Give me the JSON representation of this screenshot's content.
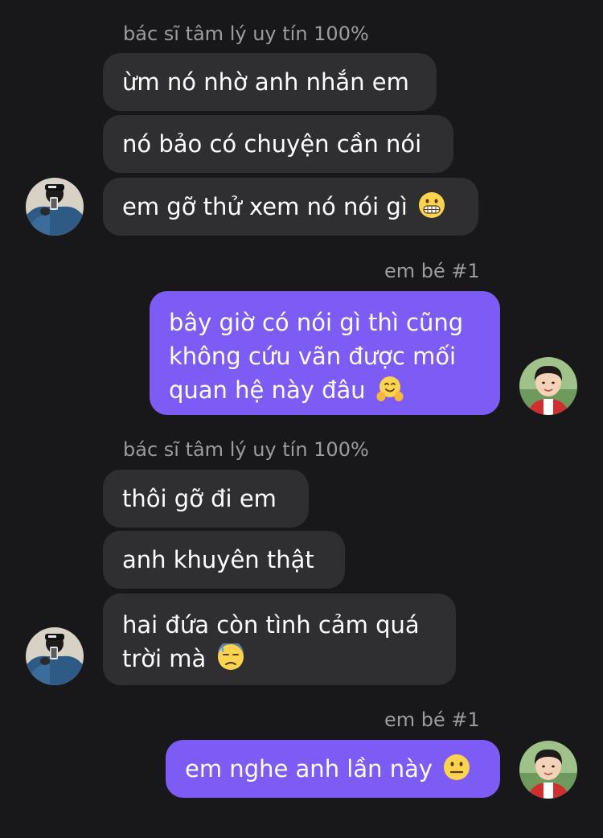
{
  "conversation": {
    "groups": [
      {
        "sender": "bác sĩ tâm lý uy tín 100%",
        "direction": "incoming",
        "avatar": "avatar-man-hoodie-icon",
        "messages": [
          {
            "text": "ừm nó nhờ anh nhắn em"
          },
          {
            "text": "nó bảo có chuyện cần nói"
          },
          {
            "text": "em gỡ thử xem nó nói gì",
            "emoji": "grimacing-face-icon"
          }
        ]
      },
      {
        "sender": "em bé #1",
        "direction": "outgoing",
        "avatar": "avatar-child-icon",
        "messages": [
          {
            "lines": [
              "bây giờ có nói gì thì cũng",
              "không cứu vãn được mối",
              "quan hệ này đâu"
            ],
            "emoji": "hugging-face-icon"
          }
        ]
      },
      {
        "sender": "bác sĩ tâm lý uy tín 100%",
        "direction": "incoming",
        "avatar": "avatar-man-hoodie-icon",
        "messages": [
          {
            "text": "thôi gỡ đi em"
          },
          {
            "text": "anh khuyên thật"
          },
          {
            "lines": [
              "hai đứa còn tình cảm quá",
              "trời mà"
            ],
            "emoji": "downcast-sweat-face-icon"
          }
        ]
      },
      {
        "sender": "em bé #1",
        "direction": "outgoing",
        "avatar": "avatar-child-icon",
        "messages": [
          {
            "text": "em nghe anh lần này",
            "emoji": "neutral-face-icon"
          }
        ]
      }
    ]
  },
  "colors": {
    "background": "#18181a",
    "incoming_bubble": "#2f2f32",
    "outgoing_bubble": "#7d5cf6",
    "sender_name": "#9c9ca1",
    "text": "#ffffff"
  }
}
